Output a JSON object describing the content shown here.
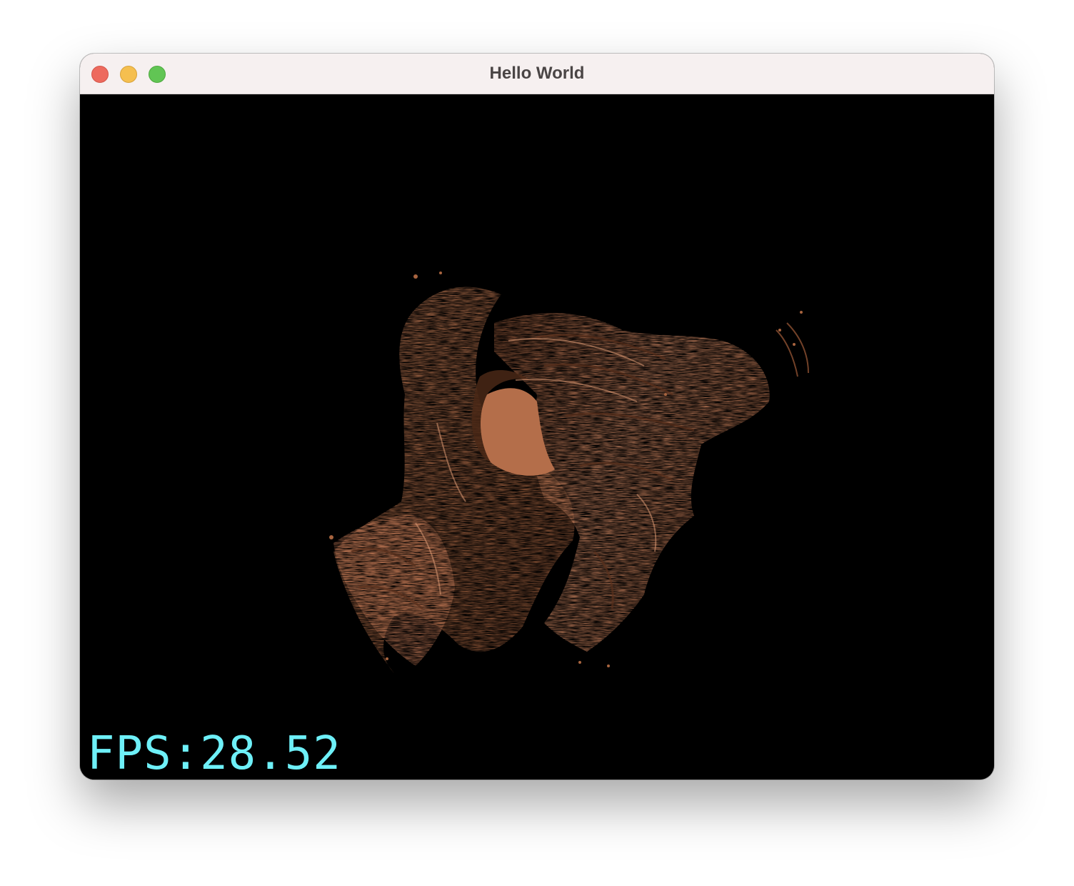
{
  "window": {
    "title": "Hello World"
  },
  "controls": {
    "close": "close-button",
    "minimize": "minimize-button",
    "maximize": "maximize-button"
  },
  "colors": {
    "background": "#000000",
    "object": "#b46e4a",
    "object_highlight": "#d08a62",
    "object_shadow": "#6a3a22",
    "overlay_text": "#6ef0f8"
  },
  "overlay": {
    "fps_text": "FPS:28.52"
  }
}
